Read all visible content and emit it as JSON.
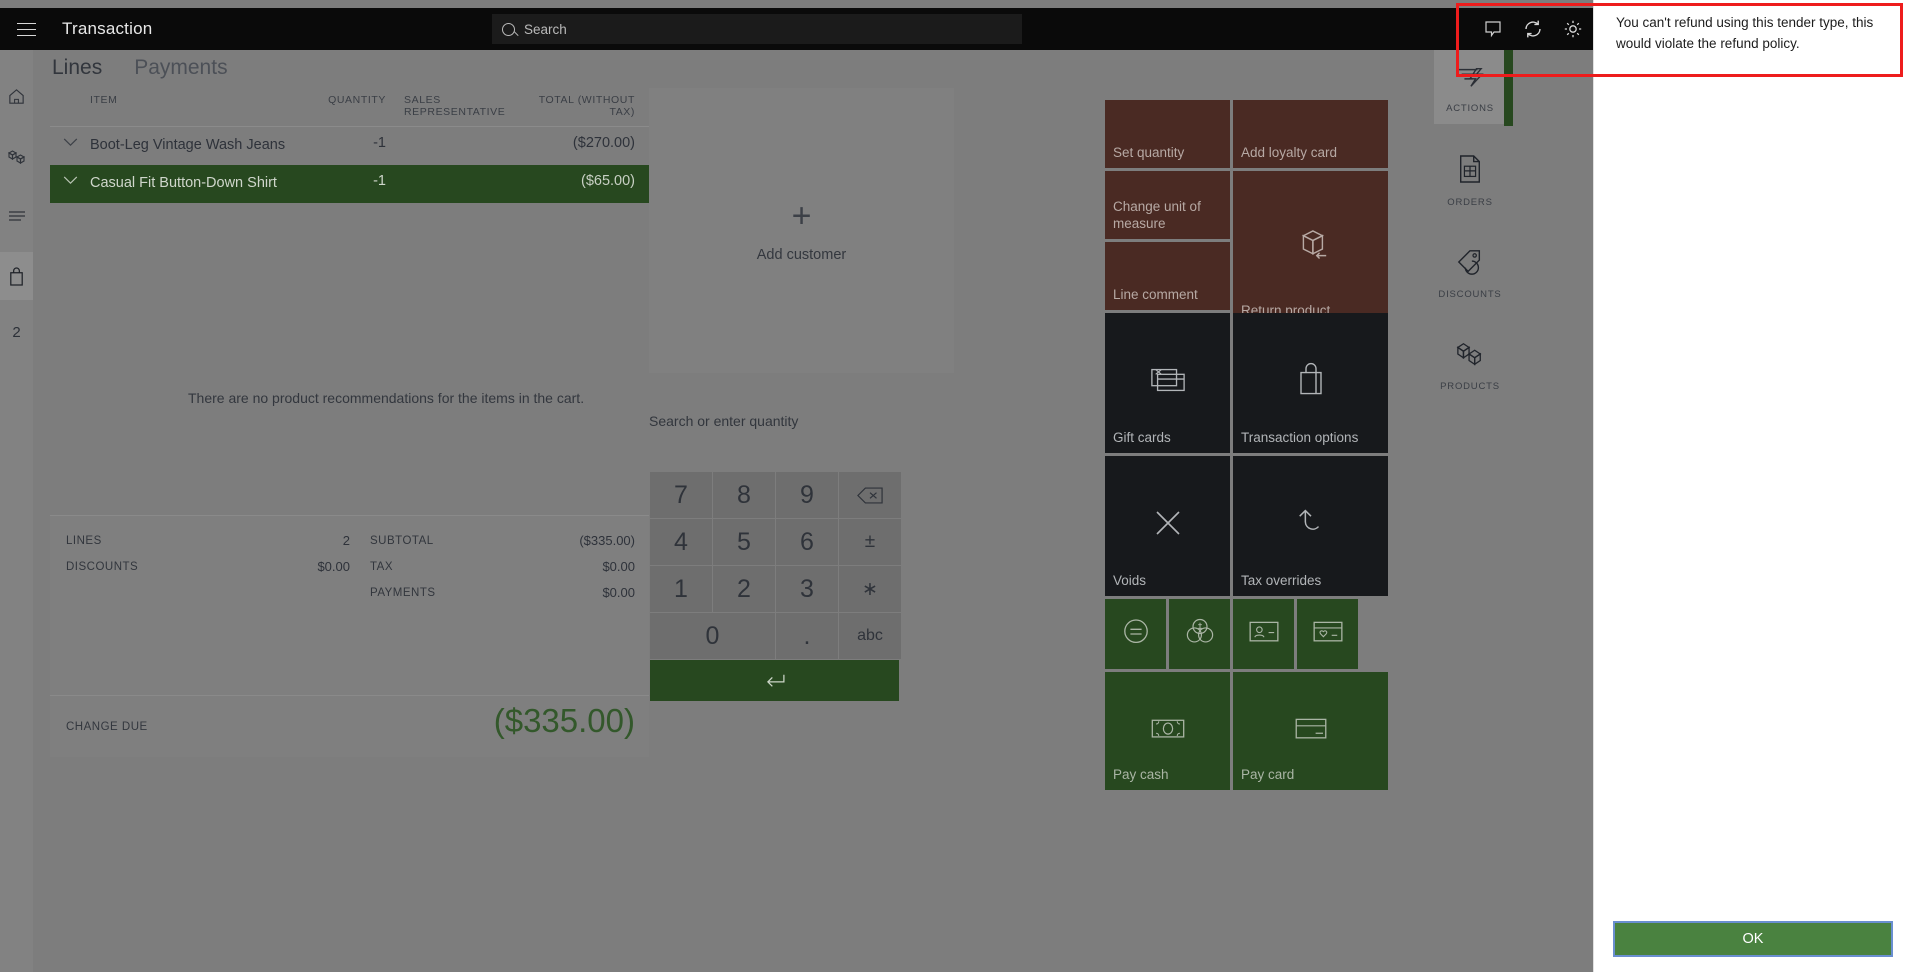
{
  "topbar": {
    "title": "Transaction",
    "menu_icon": "hamburger-icon",
    "search_placeholder": "Search",
    "icons": [
      "comment-icon",
      "refresh-icon",
      "settings-gear-icon"
    ]
  },
  "left_rail": {
    "items": [
      {
        "name": "home-icon",
        "label": ""
      },
      {
        "name": "inventory-icon",
        "label": ""
      },
      {
        "name": "list-icon",
        "label": ""
      },
      {
        "name": "cart-bag-icon",
        "label": "",
        "active": true
      }
    ],
    "count_badge": "2"
  },
  "tabs": [
    {
      "label": "Lines",
      "active": true
    },
    {
      "label": "Payments",
      "active": false
    }
  ],
  "lines_table": {
    "headers": [
      "ITEM",
      "QUANTITY",
      "SALES REPRESENTATIVE",
      "TOTAL (WITHOUT TAX)"
    ],
    "rows": [
      {
        "item": "Boot-Leg Vintage Wash Jeans",
        "quantity": "-1",
        "rep": "",
        "total": "($270.00)",
        "selected": false
      },
      {
        "item": "Casual Fit Button-Down Shirt",
        "quantity": "-1",
        "rep": "",
        "total": "($65.00)",
        "selected": true
      }
    ]
  },
  "recommendations_message": "There are no product recommendations for the items in the cart.",
  "customer_panel": {
    "add_label": "Add customer",
    "plus": "+"
  },
  "totals": {
    "left": [
      {
        "label": "LINES",
        "value": "2"
      },
      {
        "label": "DISCOUNTS",
        "value": "$0.00"
      }
    ],
    "right": [
      {
        "label": "SUBTOTAL",
        "value": "($335.00)"
      },
      {
        "label": "TAX",
        "value": "$0.00"
      },
      {
        "label": "PAYMENTS",
        "value": "$0.00"
      }
    ],
    "change_due_label": "CHANGE DUE",
    "change_due_value": "($335.00)",
    "change_due_color": "#33582b"
  },
  "numpad": {
    "search_placeholder": "Search or enter quantity",
    "keys": [
      "7",
      "8",
      "9",
      "backspace",
      "4",
      "5",
      "6",
      "±",
      "1",
      "2",
      "3",
      "∗",
      "0",
      ".",
      "abc"
    ],
    "enter_icon": "enter-arrow-icon"
  },
  "tiles": [
    {
      "label": "Set quantity",
      "color": "brown",
      "icon": ""
    },
    {
      "label": "Add loyalty card",
      "color": "brown",
      "icon": ""
    },
    {
      "label": "Change unit of measure",
      "color": "brown",
      "icon": ""
    },
    {
      "label": "Return product",
      "color": "brown",
      "icon": "return-box-icon"
    },
    {
      "label": "Line comment",
      "color": "brown",
      "icon": ""
    },
    {
      "label": "Gift cards",
      "color": "dark",
      "icon": "gift-card-icon"
    },
    {
      "label": "Transaction options",
      "color": "dark",
      "icon": "shopping-bag-icon"
    },
    {
      "label": "Voids",
      "color": "dark",
      "icon": "x-close-icon"
    },
    {
      "label": "Tax overrides",
      "color": "dark",
      "icon": "undo-arrow-icon"
    },
    {
      "label": "",
      "color": "green",
      "icon": "equals-circle-icon"
    },
    {
      "label": "",
      "color": "green",
      "icon": "currency-coins-icon"
    },
    {
      "label": "",
      "color": "green",
      "icon": "id-card-icon"
    },
    {
      "label": "",
      "color": "green",
      "icon": "gift-card-heart-icon"
    },
    {
      "label": "Pay cash",
      "color": "green",
      "icon": "cash-bill-icon"
    },
    {
      "label": "Pay card",
      "color": "green",
      "icon": "credit-card-icon"
    }
  ],
  "nav_rail": [
    {
      "label": "ACTIONS",
      "icon": "actions-lightning-icon",
      "active": true
    },
    {
      "label": "ORDERS",
      "icon": "orders-document-icon",
      "active": false
    },
    {
      "label": "DISCOUNTS",
      "icon": "discount-tag-icon",
      "active": false
    },
    {
      "label": "PRODUCTS",
      "icon": "products-boxes-icon",
      "active": false
    }
  ],
  "dialog": {
    "message": "You can't refund using this tender type, this would violate the refund policy.",
    "ok_label": "OK",
    "accent_color": "#4a8240",
    "highlight_color": "#ee1c1c"
  }
}
